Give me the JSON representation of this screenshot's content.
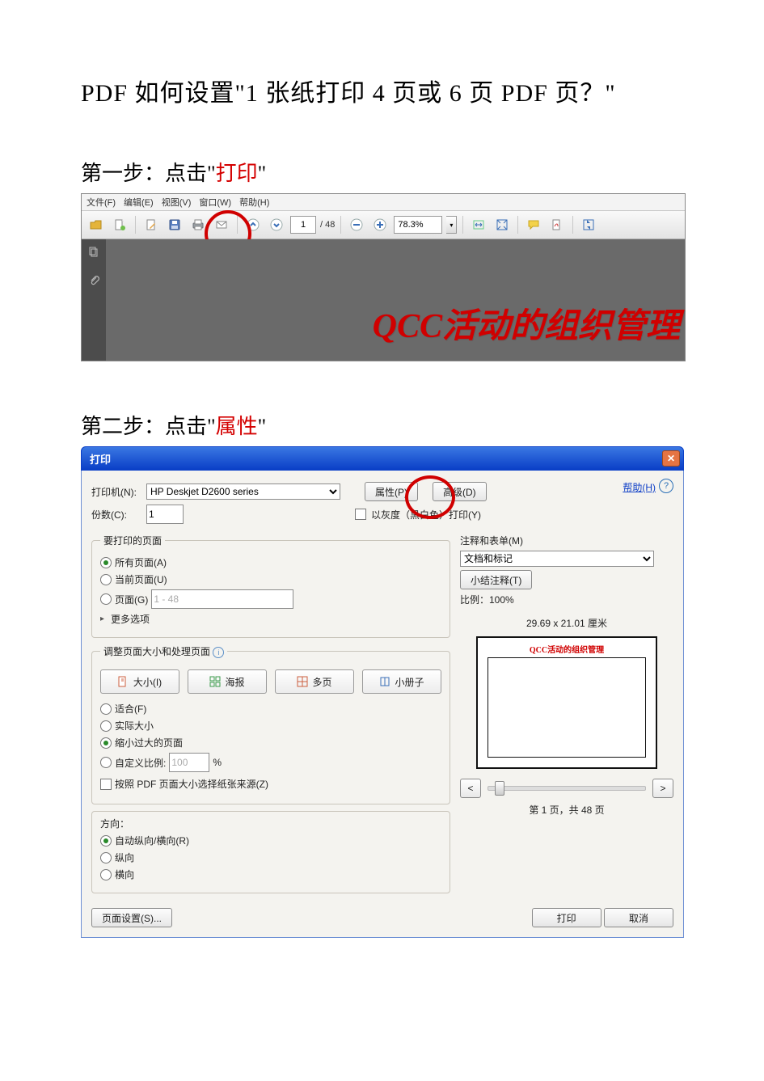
{
  "doc": {
    "title": "PDF 如何设置\"1 张纸打印 4 页或 6 页 PDF 页？\"",
    "step1_prefix": "第一步：点击\"",
    "step1_red": "打印",
    "step1_suffix": "\"",
    "step2_prefix": "第二步：点击\"",
    "step2_red": "属性",
    "step2_suffix": "\""
  },
  "viewer": {
    "menus": [
      "文件(F)",
      "编辑(E)",
      "视图(V)",
      "窗口(W)",
      "帮助(H)"
    ],
    "page_current": "1",
    "page_total": "/ 48",
    "zoom": "78.3%",
    "content_title": "QCC活动的组织管理"
  },
  "dialog": {
    "title": "打印",
    "help_link": "帮助(H)",
    "printer": {
      "label": "打印机(N):",
      "value": "HP Deskjet D2600 series",
      "properties_btn": "属性(P)",
      "advanced_btn": "高级(D)"
    },
    "copies": {
      "label": "份数(C):",
      "value": "1"
    },
    "grayscale": "以灰度（黑白色）打印(Y)",
    "range": {
      "legend": "要打印的页面",
      "all": "所有页面(A)",
      "current": "当前页面(U)",
      "pages": "页面(G)",
      "pages_value": "1 - 48",
      "more": "更多选项"
    },
    "handling": {
      "legend": "调整页面大小和处理页面",
      "tabs": {
        "size": "大小(I)",
        "poster": "海报",
        "multi": "多页",
        "booklet": "小册子"
      },
      "fit": "适合(F)",
      "actual": "实际大小",
      "shrink": "缩小过大的页面",
      "custom": "自定义比例:",
      "custom_value": "100",
      "percent": "%",
      "source": "按照 PDF 页面大小选择纸张来源(Z)"
    },
    "orient": {
      "legend": "方向：",
      "auto": "自动纵向/横向(R)",
      "portrait": "纵向",
      "landscape": "横向"
    },
    "annot": {
      "legend": "注释和表单(M)",
      "value": "文档和标记",
      "summary_btn": "小结注释(T)",
      "scale_label": "比例：100%"
    },
    "preview": {
      "dims": "29.69 x 21.01 厘米",
      "title": "QCC活动的组织管理",
      "page_of": "第 1 页，共 48 页"
    },
    "buttons": {
      "page_setup": "页面设置(S)...",
      "print": "打印",
      "cancel": "取消"
    }
  }
}
